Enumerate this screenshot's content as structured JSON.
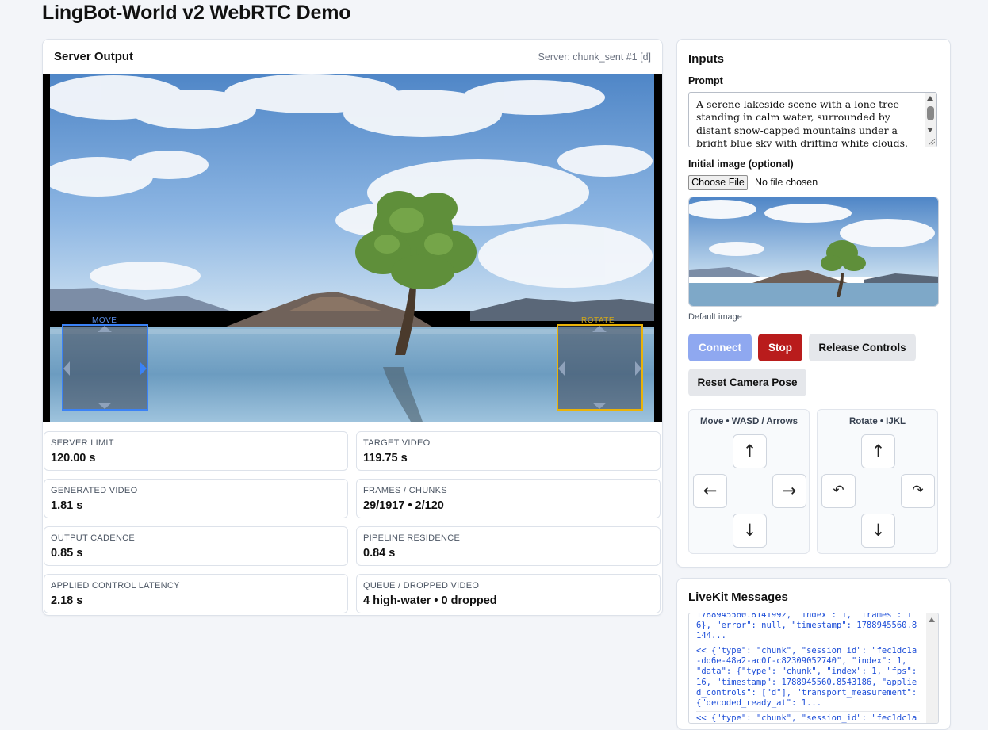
{
  "page": {
    "title": "LingBot-World v2 WebRTC Demo"
  },
  "server_output": {
    "title": "Server Output",
    "status": "Server: chunk_sent #1 [d]",
    "overlay": {
      "move_label": "MOVE",
      "rotate_label": "ROTATE",
      "move_color": "#3b82f6",
      "rotate_color": "#eab308"
    },
    "stats": [
      {
        "label": "SERVER LIMIT",
        "value": "120.00 s"
      },
      {
        "label": "TARGET VIDEO",
        "value": "119.75 s"
      },
      {
        "label": "GENERATED VIDEO",
        "value": "1.81 s"
      },
      {
        "label": "FRAMES / CHUNKS",
        "value": "29/1917 • 2/120"
      },
      {
        "label": "OUTPUT CADENCE",
        "value": "0.85 s"
      },
      {
        "label": "PIPELINE RESIDENCE",
        "value": "0.84 s"
      },
      {
        "label": "APPLIED CONTROL LATENCY",
        "value": "2.18 s"
      },
      {
        "label": "QUEUE / DROPPED VIDEO",
        "value": "4 high-water • 0 dropped"
      }
    ]
  },
  "inputs": {
    "title": "Inputs",
    "prompt_label": "Prompt",
    "prompt_value": "A serene lakeside scene with a lone tree standing in calm water, surrounded by distant snow-capped mountains under a bright blue sky with drifting white clouds.",
    "image_label": "Initial image (optional)",
    "choose_file": "Choose File",
    "no_file": "No file chosen",
    "image_caption": "Default image",
    "buttons": {
      "connect": "Connect",
      "stop": "Stop",
      "release": "Release Controls",
      "reset": "Reset Camera Pose"
    },
    "colors": {
      "connect": "#8fa8f0",
      "stop": "#b91c1c",
      "neutral": "#e5e7eb"
    },
    "move_panel": {
      "title": "Move • WASD / Arrows",
      "keys": {
        "up": "↑",
        "left": "←",
        "right": "→",
        "down": "↓"
      }
    },
    "rotate_panel": {
      "title": "Rotate • IJKL",
      "keys": {
        "up": "↑",
        "left": "↶",
        "right": "↷",
        "down": "↓"
      }
    }
  },
  "livekit": {
    "title": "LiveKit Messages",
    "messages": [
      "1788945560.8141992, \"index\": 1, \"frames\": 16}, \"error\": null, \"timestamp\": 1788945560.8144...",
      "<< {\"type\": \"chunk\", \"session_id\": \"fec1dc1a-dd6e-48a2-ac0f-c82309052740\", \"index\": 1, \"data\": {\"type\": \"chunk\", \"index\": 1, \"fps\": 16, \"timestamp\": 1788945560.8543186, \"applied_controls\": [\"d\"], \"transport_measurement\": {\"decoded_ready_at\": 1...",
      "<< {\"type\": \"chunk\", \"session_id\": \"fec1dc1a-"
    ]
  }
}
